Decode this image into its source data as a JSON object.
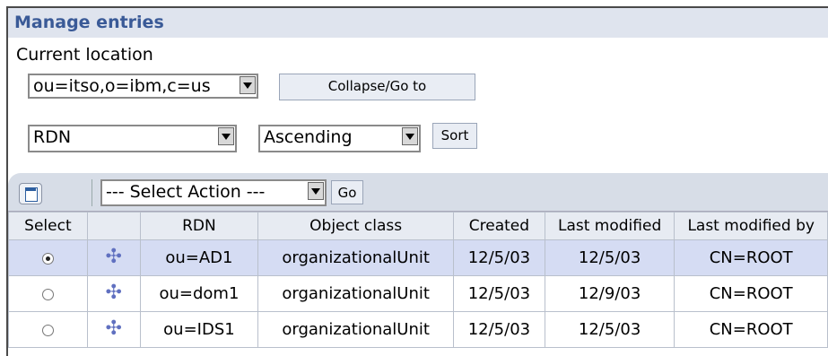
{
  "header": {
    "title": "Manage entries"
  },
  "location": {
    "label": "Current location",
    "value": "ou=itso,o=ibm,c=us",
    "button": "Collapse/Go to"
  },
  "sort": {
    "field": "RDN",
    "order": "Ascending",
    "button": "Sort"
  },
  "toolbar": {
    "action_select": "--- Select Action ---",
    "go_button": "Go"
  },
  "table": {
    "columns": [
      "Select",
      "",
      "RDN",
      "Object class",
      "Created",
      "Last modified",
      "Last modified by"
    ],
    "rows": [
      {
        "selected": true,
        "rdn": "ou=AD1",
        "object_class": "organizationalUnit",
        "created": "12/5/03",
        "modified": "12/5/03",
        "modified_by": "CN=ROOT"
      },
      {
        "selected": false,
        "rdn": "ou=dom1",
        "object_class": "organizationalUnit",
        "created": "12/5/03",
        "modified": "12/9/03",
        "modified_by": "CN=ROOT"
      },
      {
        "selected": false,
        "rdn": "ou=IDS1",
        "object_class": "organizationalUnit",
        "created": "12/5/03",
        "modified": "12/5/03",
        "modified_by": "CN=ROOT"
      }
    ]
  },
  "colors": {
    "title": "#3a5a97",
    "selected_row": "#d5dcf3",
    "header_bg": "#dfe4ee"
  }
}
